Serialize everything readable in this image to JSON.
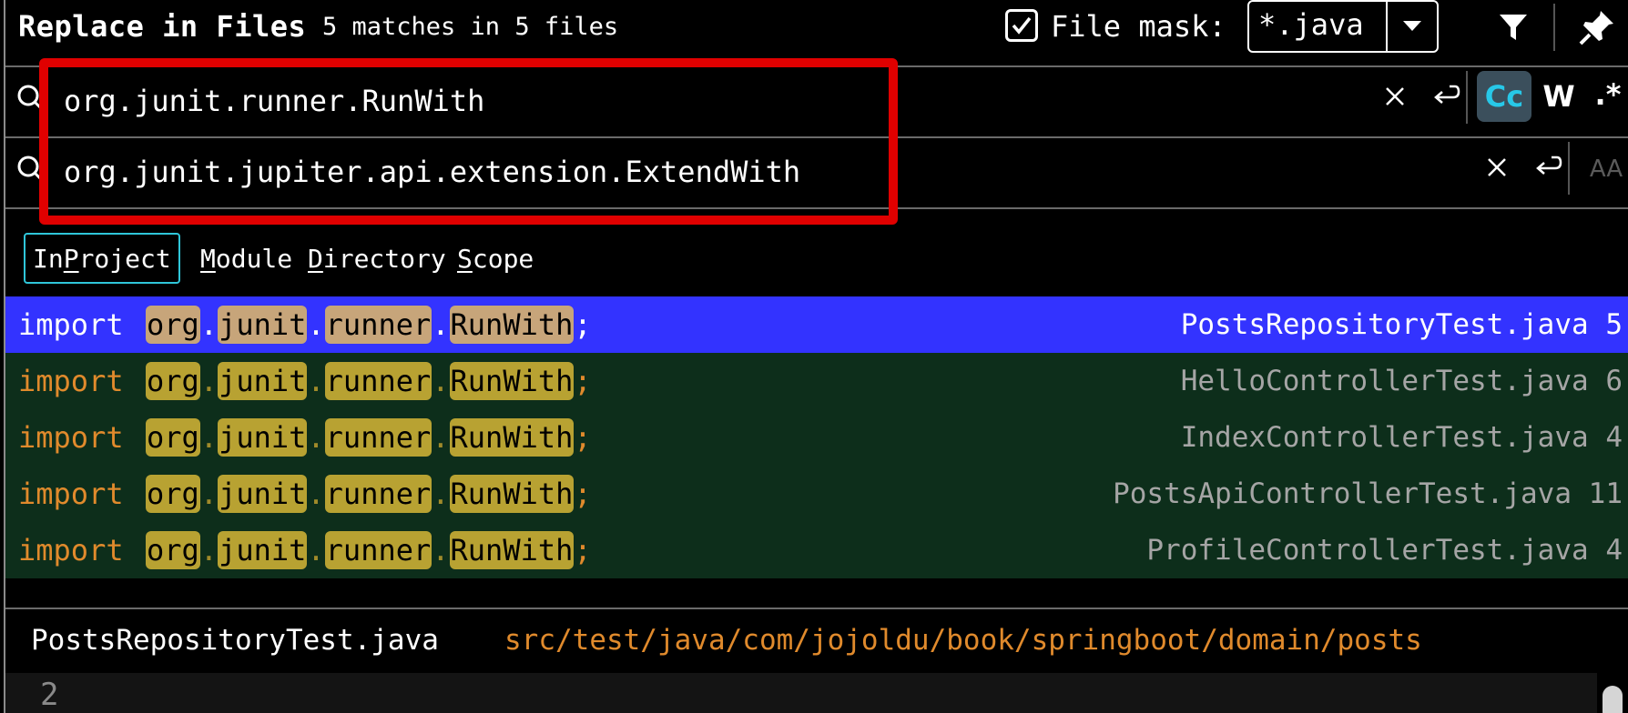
{
  "header": {
    "title": "Replace in Files",
    "subtitle": "5 matches in 5 files",
    "file_mask_label": "File mask:",
    "file_mask_checked": true,
    "file_mask_value": "*.java",
    "icons": [
      "checkbox-checked-icon",
      "chevron-down-icon",
      "filter-icon",
      "pin-icon"
    ]
  },
  "search": {
    "value": "org.junit.runner.RunWith",
    "icons": [
      "search-icon",
      "clear-icon",
      "newline-icon",
      "match-case-icon",
      "words-icon",
      "regex-icon"
    ],
    "match_case_label": "Cc",
    "words_label": "W",
    "regex_label": ".*"
  },
  "replace": {
    "value": "org.junit.jupiter.api.extension.ExtendWith",
    "icons": [
      "search-icon",
      "clear-icon",
      "newline-icon",
      "preserve-case-icon"
    ],
    "preserve_case_label": "AA"
  },
  "scope": {
    "tabs": [
      {
        "pre": "In ",
        "mn": "P",
        "post": "roject",
        "active": true
      },
      {
        "pre": "",
        "mn": "M",
        "post": "odule",
        "active": false
      },
      {
        "pre": "",
        "mn": "D",
        "post": "irectory",
        "active": false
      },
      {
        "pre": "",
        "mn": "S",
        "post": "cope",
        "active": false
      }
    ]
  },
  "results": [
    {
      "keyword": "import",
      "segments": [
        "org",
        "junit",
        "runner",
        "RunWith"
      ],
      "semicolon": ";",
      "file": "PostsRepositoryTest.java",
      "line": "5",
      "selected": true
    },
    {
      "keyword": "import",
      "segments": [
        "org",
        "junit",
        "runner",
        "RunWith"
      ],
      "semicolon": ";",
      "file": "HelloControllerTest.java",
      "line": "6",
      "selected": false
    },
    {
      "keyword": "import",
      "segments": [
        "org",
        "junit",
        "runner",
        "RunWith"
      ],
      "semicolon": ";",
      "file": "IndexControllerTest.java",
      "line": "4",
      "selected": false
    },
    {
      "keyword": "import",
      "segments": [
        "org",
        "junit",
        "runner",
        "RunWith"
      ],
      "semicolon": ";",
      "file": "PostsApiControllerTest.java",
      "line": "11",
      "selected": false
    },
    {
      "keyword": "import",
      "segments": [
        "org",
        "junit",
        "runner",
        "RunWith"
      ],
      "semicolon": ";",
      "file": "ProfileControllerTest.java",
      "line": "4",
      "selected": false
    }
  ],
  "preview": {
    "file": "PostsRepositoryTest.java",
    "path": "src/test/java/com/jojoldu/book/springboot/domain/posts",
    "line_number": "2"
  },
  "colors": {
    "highlight_box": "#e00000",
    "selected_row": "#3333ff",
    "result_row": "#0d2e1b",
    "match": "#b8a232",
    "keyword": "#e08a2c",
    "accent": "#27c8e8"
  }
}
